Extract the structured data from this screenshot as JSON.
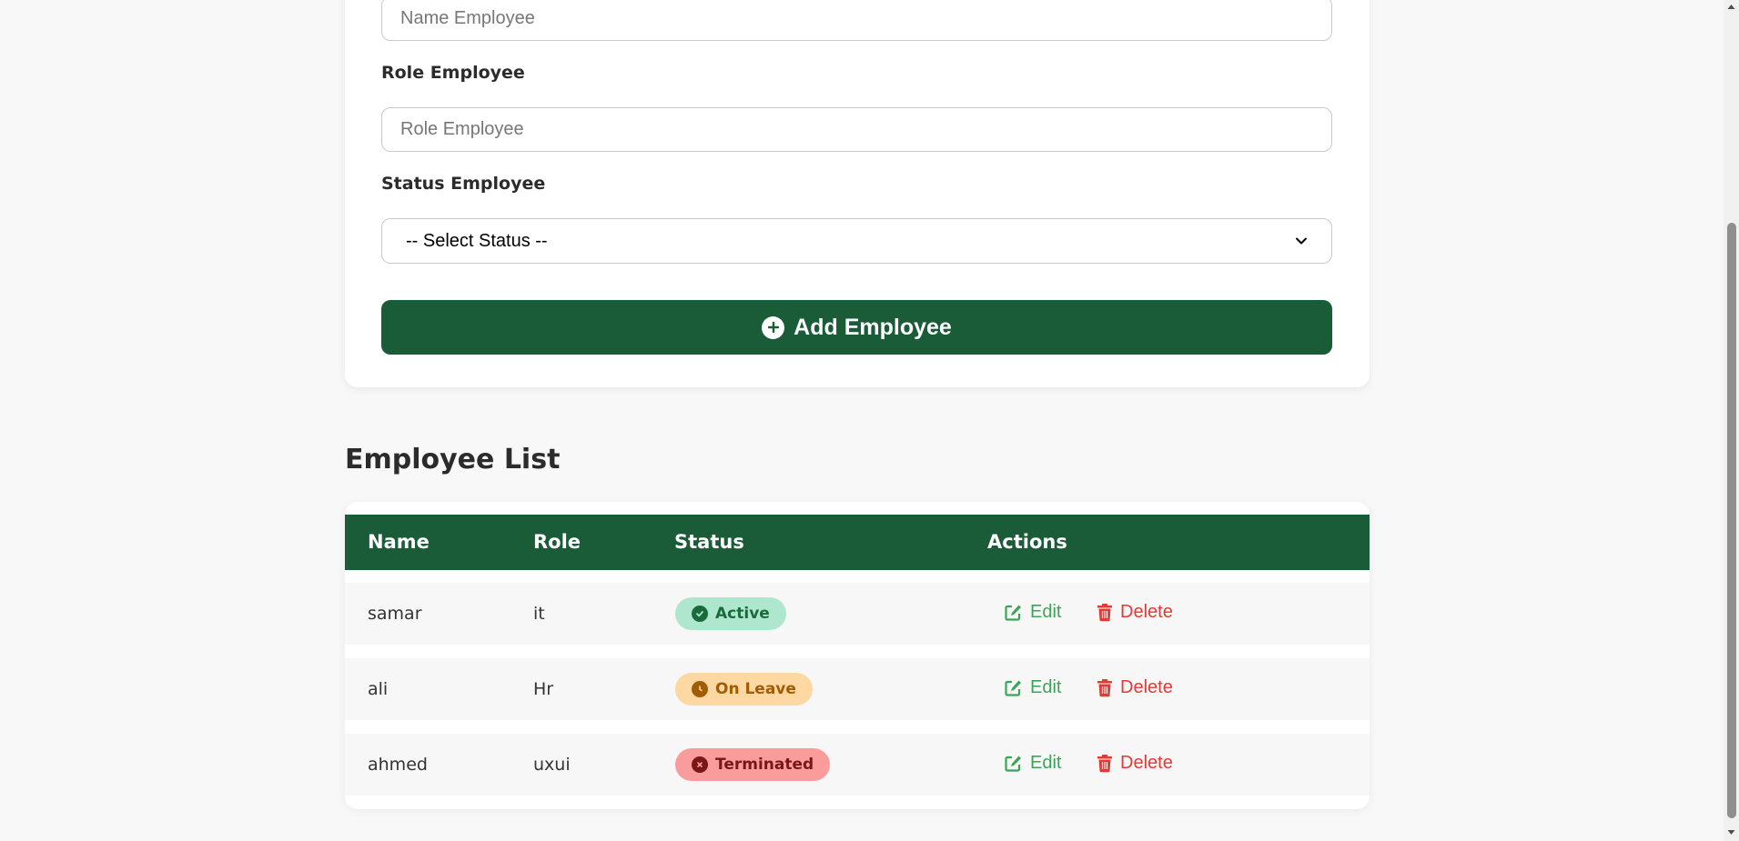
{
  "form": {
    "name_placeholder": "Name Employee",
    "role_label": "Role Employee",
    "role_placeholder": "Role Employee",
    "status_label": "Status Employee",
    "status_selected": "-- Select Status --",
    "add_button_label": "Add Employee"
  },
  "list": {
    "title": "Employee List",
    "headers": [
      "Name",
      "Role",
      "Status",
      "Actions"
    ],
    "rows": [
      {
        "name": "samar",
        "role": "it",
        "status": "Active",
        "edit": "Edit",
        "delete": "Delete"
      },
      {
        "name": "ali",
        "role": "Hr",
        "status": "On Leave",
        "edit": "Edit",
        "delete": "Delete"
      },
      {
        "name": "ahmed",
        "role": "uxui",
        "status": "Terminated",
        "edit": "Edit",
        "delete": "Delete"
      }
    ]
  },
  "colors": {
    "brand_green": "#1a5c38",
    "active_bg": "#aee6ce",
    "active_text": "#1a6b3a",
    "on_leave_bg": "#fdd8a3",
    "on_leave_text": "#a15c06",
    "terminated_bg": "#fa9c9c",
    "terminated_text": "#7a1616",
    "edit": "#3aa655",
    "delete": "#e53935"
  },
  "icons": {
    "add_button": "plus-circle-icon",
    "active": "check-circle-icon",
    "on_leave": "clock-icon",
    "terminated": "x-circle-icon",
    "edit": "edit-icon",
    "delete": "trash-icon",
    "select": "chevron-down-icon"
  }
}
